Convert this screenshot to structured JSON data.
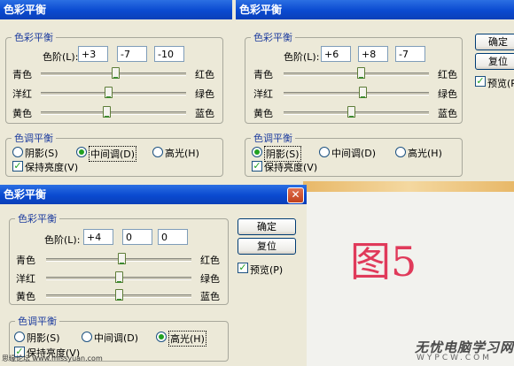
{
  "colors": {
    "title_bar": "#0a4ad0",
    "group_label": "#1d3c9e",
    "figure_label": "#e03a5a",
    "desktop_orange": "#e8b868",
    "preview_bg": "#f2f2ee"
  },
  "icons": {
    "close": "close-icon",
    "checkmark": "checkmark-icon",
    "radio_dot": "radio-dot-icon"
  },
  "strings": {
    "title": "色彩平衡",
    "color_balance_group": "色彩平衡",
    "levels_label": "色阶(L):",
    "cyan": "青色",
    "red": "红色",
    "magenta": "洋红",
    "green": "绿色",
    "yellow": "黄色",
    "blue": "蓝色",
    "tone_group": "色调平衡",
    "shadows": "阴影(S)",
    "midtones": "中间调(D)",
    "highlights": "高光(H)",
    "preserve": "保持亮度(V)",
    "ok": "确定",
    "reset": "复位",
    "preview": "预览(P)",
    "preview_cut": "预览(P",
    "close_glyph": "✕",
    "check_glyph": "✓"
  },
  "dialog1": {
    "levels": [
      "+3",
      "-7",
      "-10"
    ],
    "sliders": [
      3,
      -7,
      -10
    ],
    "tone": "midtones",
    "preserve": true
  },
  "dialog2": {
    "levels": [
      "+6",
      "+8",
      "-7"
    ],
    "sliders": [
      6,
      8,
      -7
    ],
    "tone": "shadows",
    "preserve": true
  },
  "dialog3": {
    "levels": [
      "+4",
      "0",
      "0"
    ],
    "sliders": [
      4,
      0,
      0
    ],
    "tone": "highlights",
    "preserve": true,
    "preview": true
  },
  "figure_label": "图5",
  "watermark": {
    "site_cn": "无忧电脑学习网",
    "site_en": "WYPCW.COM",
    "credit": "思缘论坛 www.missyuan.com"
  }
}
